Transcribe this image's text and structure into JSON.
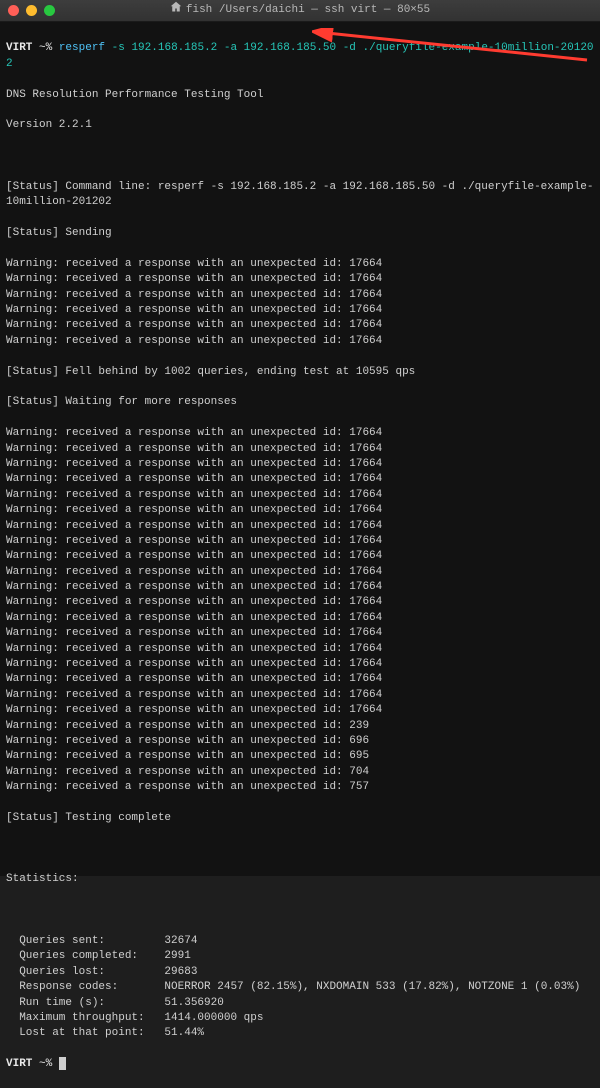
{
  "titlebar": {
    "title": "fish  /Users/daichi — ssh virt — 80×55"
  },
  "prompt1": {
    "host": "VIRT",
    "sym": "~%",
    "cmd": "resperf",
    "args": "-s 192.168.185.2 -a 192.168.185.50 -d ./queryfile-example-10million-201202"
  },
  "header": {
    "title": "DNS Resolution Performance Testing Tool",
    "version": "Version 2.2.1"
  },
  "status": {
    "cmd_label": "[Status] Command line: resperf -s 192.168.185.2 -a 192.168.185.50 -d ./queryfile-example-10million-201202",
    "sending": "[Status] Sending",
    "fell_behind": "[Status] Fell behind by 1002 queries, ending test at 10595 qps",
    "waiting": "[Status] Waiting for more responses",
    "complete": "[Status] Testing complete"
  },
  "warnings_group1": [
    "Warning: received a response with an unexpected id: 17664",
    "Warning: received a response with an unexpected id: 17664",
    "Warning: received a response with an unexpected id: 17664",
    "Warning: received a response with an unexpected id: 17664",
    "Warning: received a response with an unexpected id: 17664",
    "Warning: received a response with an unexpected id: 17664"
  ],
  "warnings_group2": [
    "Warning: received a response with an unexpected id: 17664",
    "Warning: received a response with an unexpected id: 17664",
    "Warning: received a response with an unexpected id: 17664",
    "Warning: received a response with an unexpected id: 17664",
    "Warning: received a response with an unexpected id: 17664",
    "Warning: received a response with an unexpected id: 17664",
    "Warning: received a response with an unexpected id: 17664",
    "Warning: received a response with an unexpected id: 17664",
    "Warning: received a response with an unexpected id: 17664",
    "Warning: received a response with an unexpected id: 17664",
    "Warning: received a response with an unexpected id: 17664",
    "Warning: received a response with an unexpected id: 17664",
    "Warning: received a response with an unexpected id: 17664",
    "Warning: received a response with an unexpected id: 17664",
    "Warning: received a response with an unexpected id: 17664",
    "Warning: received a response with an unexpected id: 17664",
    "Warning: received a response with an unexpected id: 17664",
    "Warning: received a response with an unexpected id: 17664",
    "Warning: received a response with an unexpected id: 17664",
    "Warning: received a response with an unexpected id: 239",
    "Warning: received a response with an unexpected id: 696",
    "Warning: received a response with an unexpected id: 695",
    "Warning: received a response with an unexpected id: 704",
    "Warning: received a response with an unexpected id: 757"
  ],
  "stats": {
    "heading": "Statistics:",
    "lines": [
      "  Queries sent:         32674",
      "  Queries completed:    2991",
      "  Queries lost:         29683",
      "  Response codes:       NOERROR 2457 (82.15%), NXDOMAIN 533 (17.82%), NOTZONE 1 (0.03%)",
      "  Run time (s):         51.356920",
      "  Maximum throughput:   1414.000000 qps",
      "  Lost at that point:   51.44%"
    ]
  },
  "prompt2": {
    "host": "VIRT",
    "sym": "~%"
  }
}
